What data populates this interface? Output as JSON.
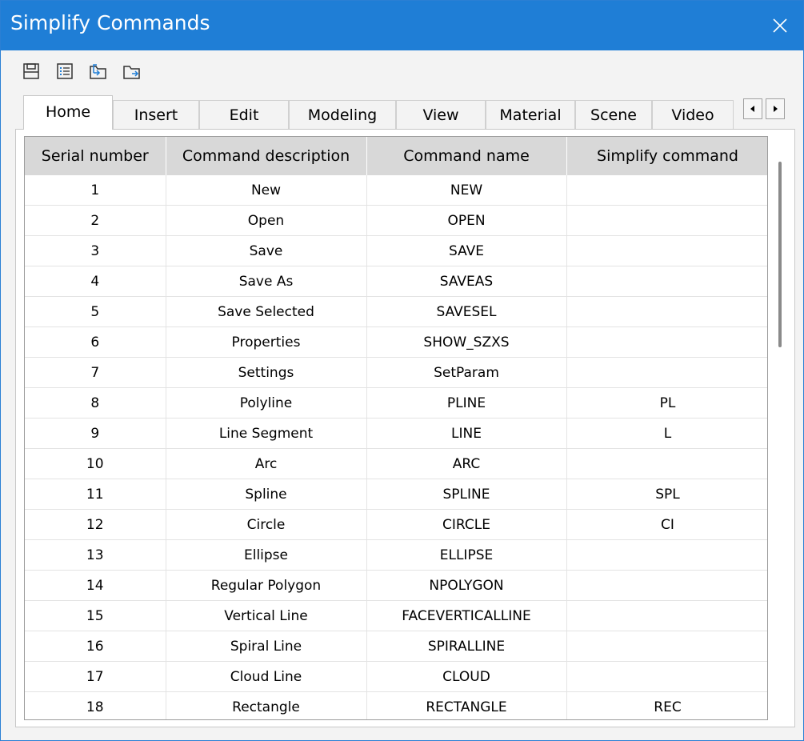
{
  "window": {
    "title": "Simplify Commands",
    "accent": "#1f7ed6"
  },
  "toolbar": {
    "buttons": [
      {
        "icon": "save-icon"
      },
      {
        "icon": "list-icon"
      },
      {
        "icon": "import-icon"
      },
      {
        "icon": "export-icon"
      }
    ]
  },
  "tabs": [
    {
      "label": "Home",
      "active": true
    },
    {
      "label": "Insert"
    },
    {
      "label": "Edit"
    },
    {
      "label": "Modeling"
    },
    {
      "label": "View"
    },
    {
      "label": "Material"
    },
    {
      "label": "Scene"
    },
    {
      "label": "Video"
    }
  ],
  "tab_scroll": {
    "left_icon": "arrow-left-icon",
    "right_icon": "arrow-right-icon"
  },
  "table": {
    "columns": [
      "Serial number",
      "Command description",
      "Command name",
      "Simplify command"
    ],
    "rows": [
      [
        "1",
        "New",
        "NEW",
        ""
      ],
      [
        "2",
        "Open",
        "OPEN",
        ""
      ],
      [
        "3",
        "Save",
        "SAVE",
        ""
      ],
      [
        "4",
        "Save As",
        "SAVEAS",
        ""
      ],
      [
        "5",
        "Save Selected",
        "SAVESEL",
        ""
      ],
      [
        "6",
        "Properties",
        "SHOW_SZXS",
        ""
      ],
      [
        "7",
        "Settings",
        "SetParam",
        ""
      ],
      [
        "8",
        "Polyline",
        "PLINE",
        "PL"
      ],
      [
        "9",
        "Line Segment",
        "LINE",
        "L"
      ],
      [
        "10",
        "Arc",
        "ARC",
        ""
      ],
      [
        "11",
        "Spline",
        "SPLINE",
        "SPL"
      ],
      [
        "12",
        "Circle",
        "CIRCLE",
        "CI"
      ],
      [
        "13",
        "Ellipse",
        "ELLIPSE",
        ""
      ],
      [
        "14",
        "Regular Polygon",
        "NPOLYGON",
        ""
      ],
      [
        "15",
        "Vertical Line",
        "FACEVERTICALLINE",
        ""
      ],
      [
        "16",
        "Spiral Line",
        "SPIRALLINE",
        ""
      ],
      [
        "17",
        "Cloud Line",
        "CLOUD",
        ""
      ],
      [
        "18",
        "Rectangle",
        "RECTANGLE",
        "REC"
      ]
    ]
  }
}
